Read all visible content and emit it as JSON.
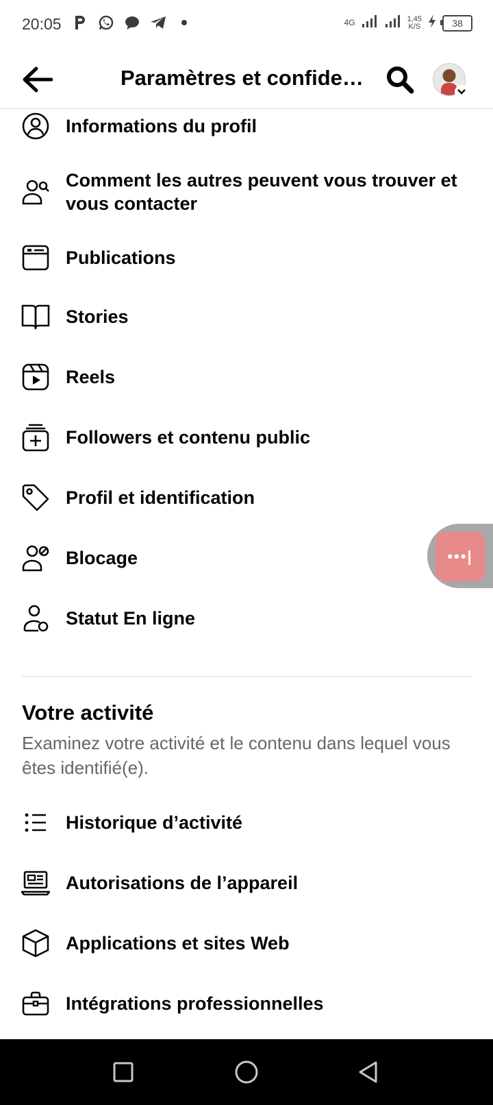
{
  "status_bar": {
    "time": "20:05",
    "network": "4G",
    "speed_value": "1,45",
    "speed_unit": "K/S",
    "battery": "38"
  },
  "header": {
    "title": "Paramètres et confidentialité"
  },
  "privacy_items": [
    {
      "label": "Informations du profil",
      "icon": "user-circle-icon"
    },
    {
      "label": "Comment les autres peuvent vous trouver et vous contacter",
      "icon": "user-search-icon"
    },
    {
      "label": "Publications",
      "icon": "posts-icon"
    },
    {
      "label": "Stories",
      "icon": "book-icon"
    },
    {
      "label": "Reels",
      "icon": "reels-icon"
    },
    {
      "label": "Followers et contenu public",
      "icon": "followers-icon"
    },
    {
      "label": "Profil et identification",
      "icon": "tag-icon"
    },
    {
      "label": "Blocage",
      "icon": "block-user-icon"
    },
    {
      "label": "Statut En ligne",
      "icon": "online-status-icon"
    }
  ],
  "activity_section": {
    "title": "Votre activité",
    "description": "Examinez votre activité et le contenu dans lequel vous êtes identifié(e).",
    "items": [
      {
        "label": "Historique d’activité",
        "icon": "list-icon"
      },
      {
        "label": "Autorisations de l’appareil",
        "icon": "laptop-icon"
      },
      {
        "label": "Applications et sites Web",
        "icon": "cube-icon"
      },
      {
        "label": "Intégrations professionnelles",
        "icon": "briefcase-icon"
      }
    ]
  },
  "floating_bubble": {
    "label": "•••|"
  }
}
